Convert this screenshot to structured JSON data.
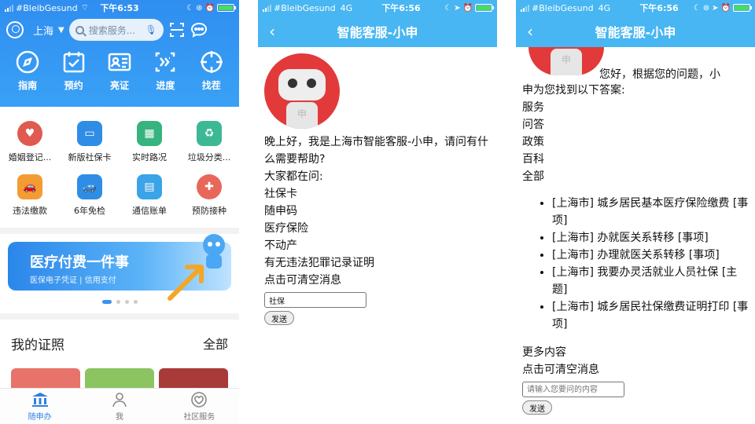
{
  "status_p1": {
    "carrier": "#BleibGesund",
    "time": "下午6:53"
  },
  "status_p2": {
    "carrier": "#BleibGesund",
    "network": "4G",
    "time": "下午6:56"
  },
  "status_p3": {
    "carrier": "#BleibGesund",
    "network": "4G",
    "time": "下午6:56"
  },
  "home": {
    "city": "上海",
    "search_placeholder": "搜索服务...",
    "quick_actions": [
      {
        "label": "指南",
        "icon": "compass-icon"
      },
      {
        "label": "预约",
        "icon": "calendar-check-icon"
      },
      {
        "label": "亮证",
        "icon": "id-card-icon"
      },
      {
        "label": "进度",
        "icon": "progress-icon"
      },
      {
        "label": "找茬",
        "icon": "target-icon"
      }
    ],
    "services": [
      {
        "label": "婚姻登记...",
        "color": "#e05a4f"
      },
      {
        "label": "新版社保卡",
        "color": "#2f8de6"
      },
      {
        "label": "实时路况",
        "color": "#36b37e"
      },
      {
        "label": "垃圾分类...",
        "color": "#3cb894"
      },
      {
        "label": "违法缴款",
        "color": "#f39c33"
      },
      {
        "label": "6年免检",
        "color": "#2f8de6"
      },
      {
        "label": "通信账单",
        "color": "#3ba3e8"
      },
      {
        "label": "预防接种",
        "color": "#e8675a"
      }
    ],
    "banner": {
      "title": "医疗付费一件事",
      "subtitle": "医保电子凭证 | 信用支付"
    },
    "certificates": {
      "title": "我的证照",
      "all_label": "全部"
    },
    "tabs": [
      {
        "label": "随申办",
        "icon": "city-hall-icon",
        "active": true
      },
      {
        "label": "我",
        "icon": "person-icon",
        "active": false
      },
      {
        "label": "社区服务",
        "icon": "heart-icon",
        "active": false
      }
    ]
  },
  "chat1": {
    "title": "智能客服-小申",
    "greeting": "晚上好，我是上海市智能客服-小申，请问有什么需要帮助?",
    "asked_header": "大家都在问:",
    "asked": [
      "社保卡",
      "随申码",
      "医疗保险",
      "不动产",
      "有无违法犯罪记录证明"
    ],
    "clear": "点击可清空消息",
    "input_value": "社保",
    "send_label": "发送"
  },
  "chat2": {
    "title": "智能客服-小申",
    "reply_intro_1": "您好，根据您的问题，小",
    "reply_intro_2": "申为您找到以下答案:",
    "categories": [
      "服务",
      "问答",
      "政策",
      "百科",
      "全部"
    ],
    "results": [
      "[上海市] 城乡居民基本医疗保险缴费 [事项]",
      "[上海市] 办就医关系转移 [事项]",
      "[上海市] 办理就医关系转移 [事项]",
      "[上海市] 我要办灵活就业人员社保 [主题]",
      "[上海市] 城乡居民社保缴费证明打印 [事项]"
    ],
    "more": "更多内容",
    "clear": "点击可清空消息",
    "input_placeholder": "请输入您要问的内容",
    "send_label": "发送"
  },
  "colors": {
    "primary_blue": "#2f8ef0",
    "nav_blue": "#48b6f2",
    "robot_red": "#e23a3a",
    "battery_green": "#4cd964"
  }
}
